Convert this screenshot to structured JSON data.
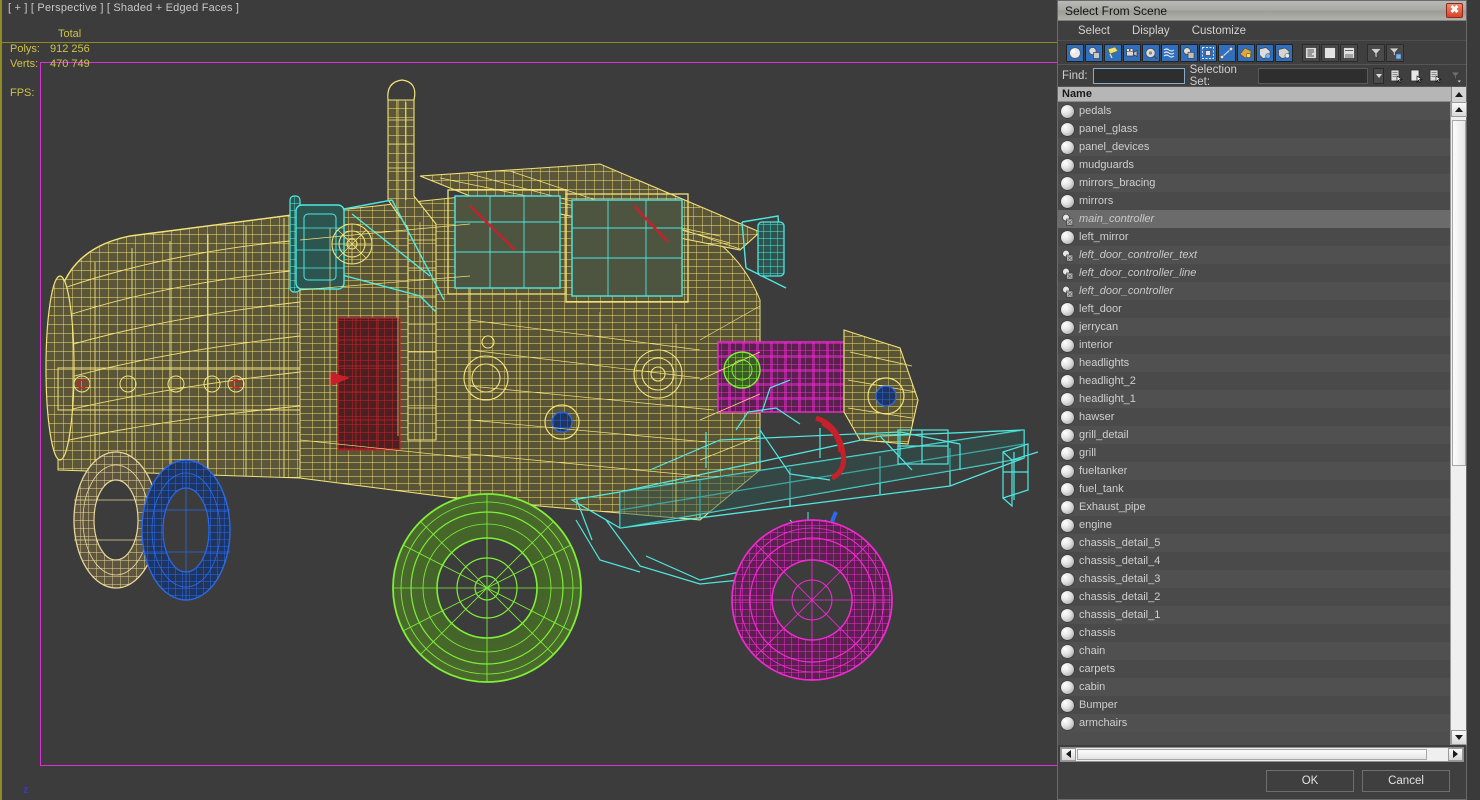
{
  "viewport": {
    "label": "[ + ] [ Perspective ] [ Shaded + Edged Faces ]",
    "stats": {
      "total_header": "Total",
      "polys_label": "Polys:",
      "polys_value": "912 256",
      "verts_label": "Verts:",
      "verts_value": "470 749",
      "fps_label": "FPS:",
      "fps_value": ""
    },
    "axis_z": "z",
    "colors": {
      "background": "#3c3c3c",
      "active_border": "#8f8a23",
      "selection_rect": "#d732d7",
      "stat_text": "#d0c14a",
      "axis_z": "#3838c8"
    },
    "model": {
      "description": "Wireframe 3D truck (fuel tanker) in shaded + edged faces mode",
      "wire_colors": {
        "body": "#f2e27a",
        "cyan": "#4fe8e0",
        "red": "#c8202a",
        "magenta": "#f02ad0",
        "green": "#7ef038",
        "blue": "#2a6ae8",
        "tan": "#e8d79a"
      }
    }
  },
  "dialog": {
    "title": "Select From Scene",
    "close_label": "✖",
    "menus": [
      {
        "label": "Select"
      },
      {
        "label": "Display"
      },
      {
        "label": "Customize"
      }
    ],
    "toolbar": [
      {
        "name": "display-geometry",
        "icon": "sphere-icon",
        "active": true
      },
      {
        "name": "display-shapes",
        "icon": "shapes-icon",
        "active": true
      },
      {
        "name": "display-lights",
        "icon": "light-icon",
        "active": true
      },
      {
        "name": "display-cameras",
        "icon": "camera-icon",
        "active": true
      },
      {
        "name": "display-helpers",
        "icon": "tape-helper-icon",
        "active": true
      },
      {
        "name": "display-space-warps",
        "icon": "wave-icon",
        "active": true
      },
      {
        "name": "display-groups",
        "icon": "group-icon",
        "active": true
      },
      {
        "name": "display-xrefs",
        "icon": "xref-icon",
        "active": true
      },
      {
        "name": "display-bones",
        "icon": "bone-icon",
        "active": true
      },
      {
        "name": "display-frozen",
        "icon": "frozen-icon",
        "active": true
      },
      {
        "name": "display-hidden",
        "icon": "hidden-icon",
        "active": true
      },
      {
        "name": "display-children",
        "icon": "children-icon",
        "active": true
      },
      {
        "name": "list-types",
        "icon": "list-lines-icon",
        "active": false
      },
      {
        "name": "expand-all",
        "icon": "blank-page-icon",
        "active": false
      },
      {
        "name": "collapse-all",
        "icon": "page-lines-icon",
        "active": false
      },
      {
        "name": "filter",
        "icon": "funnel-icon",
        "active": false
      },
      {
        "name": "advanced-filter",
        "icon": "funnel-config-icon",
        "active": false
      }
    ],
    "find": {
      "label": "Find:",
      "value": "",
      "placeholder": ""
    },
    "selection_set": {
      "label": "Selection Set:",
      "value": "",
      "placeholder": ""
    },
    "set_buttons": [
      {
        "name": "select-subtree-button",
        "icon": "page-pointer-icon"
      },
      {
        "name": "select-influences-button",
        "icon": "page-cursor-icon"
      },
      {
        "name": "select-dependents-button",
        "icon": "page-arrow-icon"
      }
    ],
    "column_header": "Name",
    "items": [
      {
        "name": "pedals",
        "type": "geometry",
        "selected": false
      },
      {
        "name": "panel_glass",
        "type": "geometry",
        "selected": false
      },
      {
        "name": "panel_devices",
        "type": "geometry",
        "selected": false
      },
      {
        "name": "mudguards",
        "type": "geometry",
        "selected": false
      },
      {
        "name": "mirrors_bracing",
        "type": "geometry",
        "selected": false
      },
      {
        "name": "mirrors",
        "type": "geometry",
        "selected": false
      },
      {
        "name": "main_controller",
        "type": "shape",
        "selected": true
      },
      {
        "name": "left_mirror",
        "type": "geometry",
        "selected": false
      },
      {
        "name": "left_door_controller_text",
        "type": "shape",
        "selected": false
      },
      {
        "name": "left_door_controller_line",
        "type": "shape",
        "selected": false
      },
      {
        "name": "left_door_controller",
        "type": "shape",
        "selected": false
      },
      {
        "name": "left_door",
        "type": "geometry",
        "selected": false
      },
      {
        "name": "jerrycan",
        "type": "geometry",
        "selected": false
      },
      {
        "name": "interior",
        "type": "geometry",
        "selected": false
      },
      {
        "name": "headlights",
        "type": "geometry",
        "selected": false
      },
      {
        "name": "headlight_2",
        "type": "geometry",
        "selected": false
      },
      {
        "name": "headlight_1",
        "type": "geometry",
        "selected": false
      },
      {
        "name": "hawser",
        "type": "geometry",
        "selected": false
      },
      {
        "name": "grill_detail",
        "type": "geometry",
        "selected": false
      },
      {
        "name": "grill",
        "type": "geometry",
        "selected": false
      },
      {
        "name": "fueltanker",
        "type": "geometry",
        "selected": false
      },
      {
        "name": "fuel_tank",
        "type": "geometry",
        "selected": false
      },
      {
        "name": "Exhaust_pipe",
        "type": "geometry",
        "selected": false
      },
      {
        "name": "engine",
        "type": "geometry",
        "selected": false
      },
      {
        "name": "chassis_detail_5",
        "type": "geometry",
        "selected": false
      },
      {
        "name": "chassis_detail_4",
        "type": "geometry",
        "selected": false
      },
      {
        "name": "chassis_detail_3",
        "type": "geometry",
        "selected": false
      },
      {
        "name": "chassis_detail_2",
        "type": "geometry",
        "selected": false
      },
      {
        "name": "chassis_detail_1",
        "type": "geometry",
        "selected": false
      },
      {
        "name": "chassis",
        "type": "geometry",
        "selected": false
      },
      {
        "name": "chain",
        "type": "geometry",
        "selected": false
      },
      {
        "name": "carpets",
        "type": "geometry",
        "selected": false
      },
      {
        "name": "cabin",
        "type": "geometry",
        "selected": false
      },
      {
        "name": "Bumper",
        "type": "geometry",
        "selected": false
      },
      {
        "name": "armchairs",
        "type": "geometry",
        "selected": false
      }
    ],
    "buttons": {
      "ok": "OK",
      "cancel": "Cancel"
    }
  }
}
